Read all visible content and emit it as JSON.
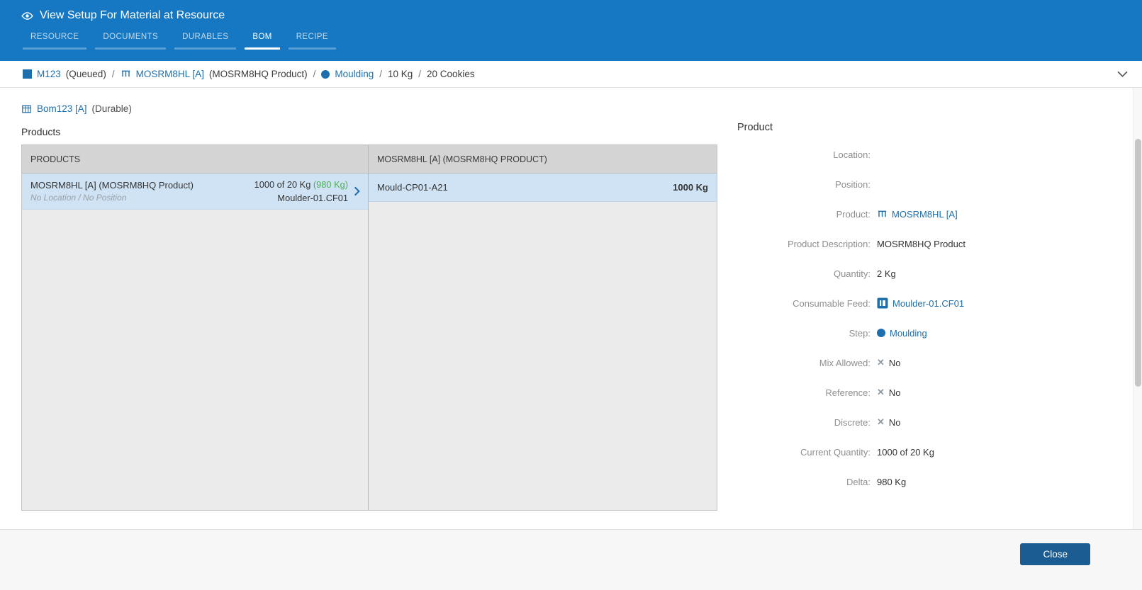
{
  "colors": {
    "header_blue": "#1678c2",
    "link_blue": "#1c6fae",
    "selected_row": "#cfe3f5",
    "delta_green": "#4caf50",
    "close_button": "#1b5c93"
  },
  "header": {
    "title": "View Setup For Material at Resource",
    "tabs": [
      {
        "label": "RESOURCE"
      },
      {
        "label": "DOCUMENTS"
      },
      {
        "label": "DURABLES"
      },
      {
        "label": "BOM"
      },
      {
        "label": "RECIPE"
      }
    ]
  },
  "breadcrumb": {
    "separator": "/",
    "material": "M123",
    "material_state": "(Queued)",
    "product": "MOSRM8HL [A]",
    "product_desc": "(MOSRM8HQ Product)",
    "step": "Moulding",
    "quantity": "10 Kg",
    "secondary_quantity": "20 Cookies"
  },
  "bom": {
    "name": "Bom123 [A]",
    "type": "(Durable)",
    "section_title": "Products",
    "products_table": {
      "header": "PRODUCTS",
      "row": {
        "name": "MOSRM8HL [A] (MOSRM8HQ Product)",
        "location": "No Location / No Position",
        "quantity": "1000 of 20 Kg",
        "delta": "(980 Kg)",
        "feed": "Moulder-01.CF01"
      }
    },
    "tracking_table": {
      "header": "MOSRM8HL [A] (MOSRM8HQ PRODUCT)",
      "row": {
        "name": "Mould-CP01-A21",
        "quantity": "1000 Kg"
      }
    }
  },
  "product_panel": {
    "title": "Product",
    "fields": [
      {
        "label": "Location:",
        "value": ""
      },
      {
        "label": "Position:",
        "value": ""
      },
      {
        "label": "Product:",
        "value": "MOSRM8HL [A]"
      },
      {
        "label": "Product Description:",
        "value": "MOSRM8HQ Product"
      },
      {
        "label": "Quantity:",
        "value": "2 Kg"
      },
      {
        "label": "Consumable Feed:",
        "value": "Moulder-01.CF01"
      },
      {
        "label": "Step:",
        "value": "Moulding"
      },
      {
        "label": "Mix Allowed:",
        "value": "No"
      },
      {
        "label": "Reference:",
        "value": "No"
      },
      {
        "label": "Discrete:",
        "value": "No"
      },
      {
        "label": "Current Quantity:",
        "value": "1000 of 20 Kg"
      },
      {
        "label": "Delta:",
        "value": "980 Kg"
      }
    ],
    "no_icon": "✕"
  },
  "footer": {
    "close_label": "Close"
  }
}
